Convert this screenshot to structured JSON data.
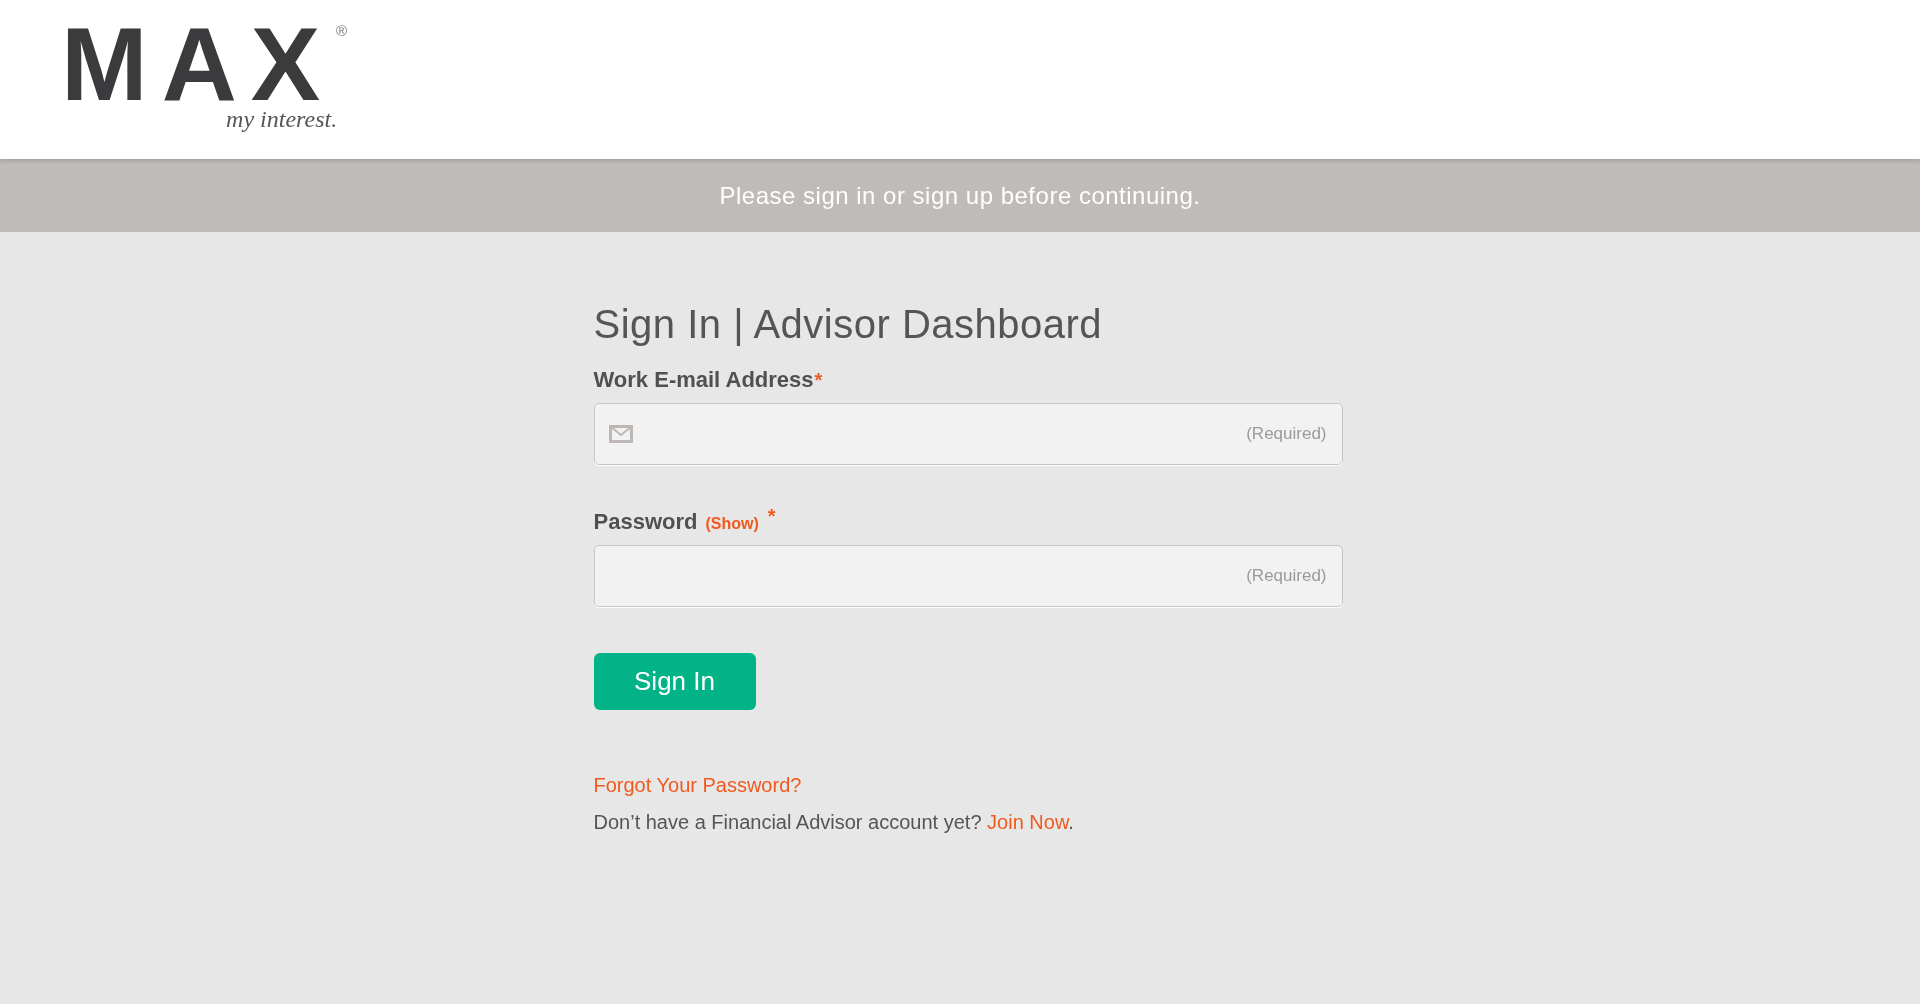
{
  "header": {
    "logo": {
      "wordmark": "MAX",
      "registered": "®",
      "tagline": "my interest."
    }
  },
  "notice": "Please sign in or sign up before continuing.",
  "form": {
    "title": "Sign In | Advisor Dashboard",
    "fields": [
      {
        "kind": "email",
        "label": "Work E-mail Address",
        "required_mark": "*",
        "placeholder": "(Required)"
      },
      {
        "kind": "password",
        "label": "Password",
        "toggle": "(Show)",
        "required_mark": "*",
        "placeholder": "(Required)"
      }
    ],
    "submit": "Sign In",
    "forgot_link": "Forgot Your Password?",
    "signup": {
      "text": "Don’t have a Financial Advisor account yet?",
      "link": "Join Now",
      "end": "."
    }
  }
}
